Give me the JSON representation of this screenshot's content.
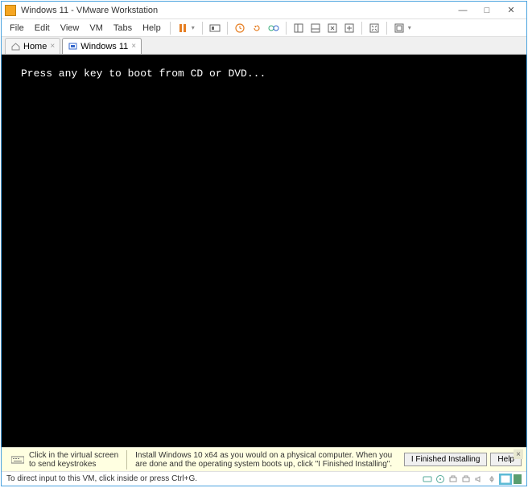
{
  "titlebar": {
    "title": "Windows 11 - VMware Workstation"
  },
  "menus": {
    "file": "File",
    "edit": "Edit",
    "view": "View",
    "vm": "VM",
    "tabs": "Tabs",
    "help": "Help"
  },
  "tabs": {
    "home": "Home",
    "vm": "Windows 11"
  },
  "vm": {
    "boot_text": "Press any key to boot from CD or DVD..."
  },
  "hint": {
    "click_line1": "Click in the virtual screen",
    "click_line2": "to send keystrokes",
    "install_msg": "Install Windows 10 x64 as you would on a physical computer. When you are done and the operating system boots up, click \"I Finished Installing\".",
    "finished_btn": "I Finished Installing",
    "help_btn": "Help"
  },
  "statusbar": {
    "msg": "To direct input to this VM, click inside or press Ctrl+G."
  }
}
